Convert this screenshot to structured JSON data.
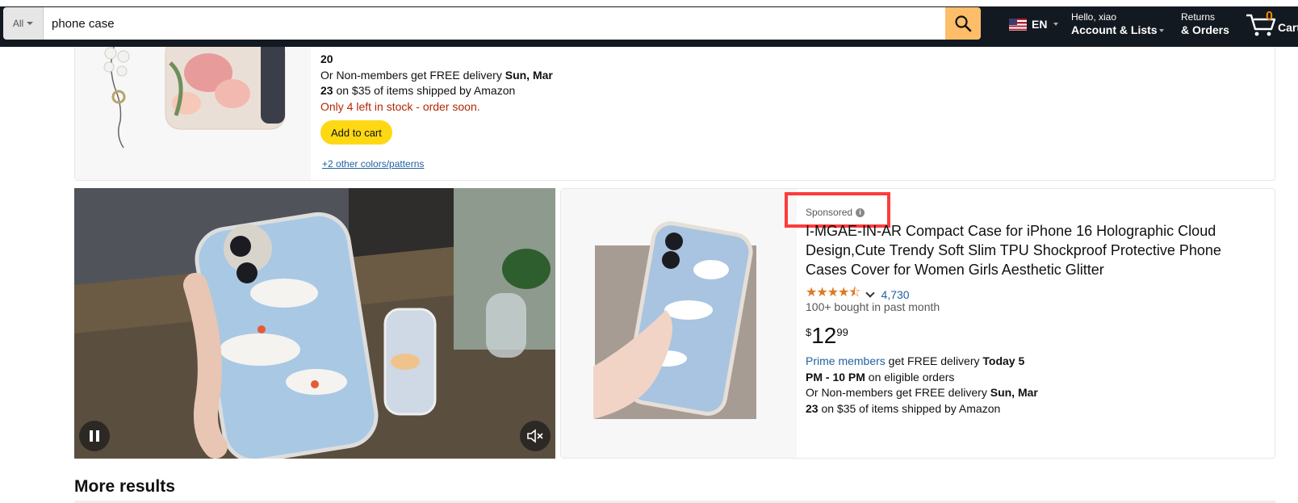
{
  "header": {
    "search_category": "All",
    "search_value": "phone case",
    "language": "EN",
    "greeting": "Hello, xiao",
    "account_label": "Account & Lists",
    "returns_label": "Returns",
    "orders_label": "& Orders",
    "cart_count": "0",
    "cart_label": "Cart"
  },
  "product1": {
    "delivery_date_fragment": "20",
    "nonmember_delivery_prefix": "Or Non-members get FREE delivery ",
    "nonmember_date": "Sun, Mar",
    "nonmember_date_2": "23",
    "nonmember_suffix": " on $35 of items shipped by Amazon",
    "stock_warning": "Only 4 left in stock - order soon.",
    "add_to_cart": "Add to cart",
    "colors_link": "+2 other colors/patterns"
  },
  "product2": {
    "sponsored_label": "Sponsored",
    "title": "I-MGAE-IN-AR Compact Case for iPhone 16 Holographic Cloud Design,Cute Trendy Soft Slim TPU Shockproof Protective Phone Cases Cover for Women Girls Aesthetic Glitter",
    "rating_count": "4,730",
    "bought": "100+ bought in past month",
    "price_symbol": "$",
    "price_whole": "12",
    "price_fraction": "99",
    "prime_link": "Prime members",
    "prime_text": " get FREE delivery ",
    "prime_date": "Today 5",
    "prime_date_2": "PM - 10 PM",
    "prime_suffix": " on eligible orders",
    "nonmember_prefix": "Or Non-members get FREE delivery ",
    "nonmember_date": "Sun, Mar",
    "nonmember_date_2": "23",
    "nonmember_suffix": " on $35 of items shipped by Amazon"
  },
  "more_results": "More results",
  "colors": {
    "nav_bg": "#131921",
    "search_button": "#febd69",
    "add_to_cart_button": "#ffd814",
    "star": "#de7921",
    "link": "#2162a1",
    "stock_warning": "#b12704",
    "highlight_box": "#ff3b3b"
  },
  "icons": {
    "search": "search-icon",
    "cart": "cart-icon",
    "pause": "pause-icon",
    "mute": "mute-icon",
    "info": "info-icon"
  }
}
